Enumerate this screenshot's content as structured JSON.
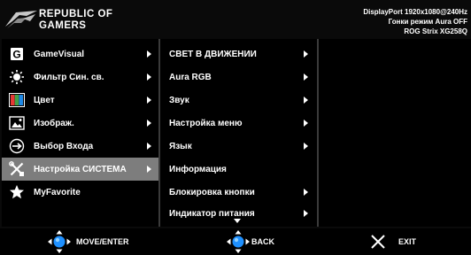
{
  "header": {
    "brand_line1": "REPUBLIC OF",
    "brand_line2": "GAMERS",
    "status_line1": "DisplayPort 1920x1080@240Hz",
    "status_line2": "Гонки режим   Aura OFF",
    "status_line3": "ROG Strix XG258Q"
  },
  "main_menu": {
    "items": [
      {
        "label": "GameVisual",
        "icon": "gamevisual-g-icon"
      },
      {
        "label": "Фильтр Син. св.",
        "icon": "blue-light-filter-icon"
      },
      {
        "label": "Цвет",
        "icon": "color-icon"
      },
      {
        "label": "Изображ.",
        "icon": "image-icon"
      },
      {
        "label": "Выбор Входа",
        "icon": "input-select-icon"
      },
      {
        "label": "Настройка СИСТЕМА",
        "icon": "system-setup-icon",
        "selected": true
      },
      {
        "label": "MyFavorite",
        "icon": "star-icon"
      }
    ]
  },
  "sub_menu": {
    "items": [
      {
        "label": "СВЕТ В ДВИЖЕНИИ",
        "has_arrow": true
      },
      {
        "label": "Aura RGB",
        "has_arrow": true
      },
      {
        "label": "Звук",
        "has_arrow": true
      },
      {
        "label": "Настройка меню",
        "has_arrow": true
      },
      {
        "label": "Язык",
        "has_arrow": true
      },
      {
        "label": "Информация",
        "has_arrow": false
      },
      {
        "label": "Блокировка кнопки",
        "has_arrow": true
      },
      {
        "label": "Индикатор питания",
        "has_arrow": true
      }
    ]
  },
  "footer": {
    "move_label": "MOVE/ENTER",
    "back_label": "BACK",
    "exit_label": "EXIT"
  },
  "colors": {
    "background": "#000000",
    "selected": "#7d7d7d",
    "joystick_blue": "#1e90ff"
  }
}
